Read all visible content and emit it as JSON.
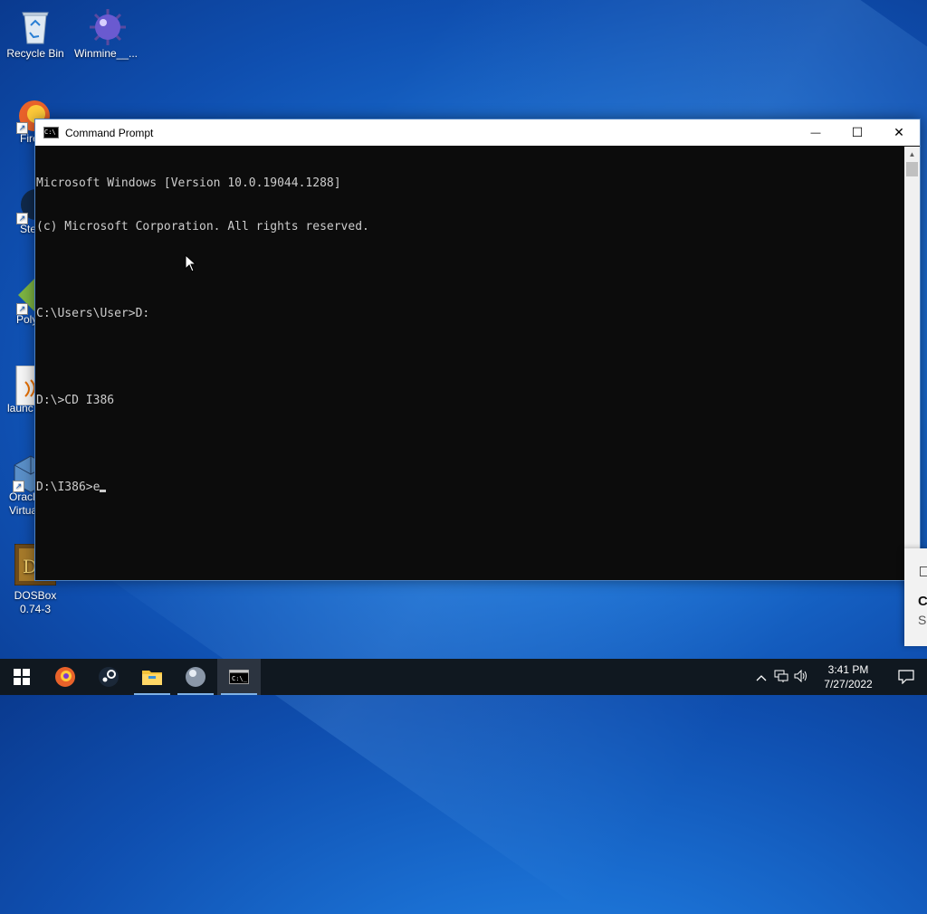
{
  "desktop": {
    "icons": [
      {
        "label": "Recycle Bin",
        "icon": "recycle-bin-icon"
      },
      {
        "label": "Winmine__...",
        "icon": "minesweeper-icon"
      },
      {
        "label": "Fire",
        "icon": "firefox-icon"
      },
      {
        "label": "Ste",
        "icon": "steam-icon"
      },
      {
        "label": "Poly",
        "icon": "poly-icon"
      },
      {
        "label": "launc",
        "icon": "java-launcher-icon"
      },
      {
        "label": "Oracl Virtua",
        "icon": "virtualbox-icon"
      },
      {
        "label": "DOSBox 0.74-3",
        "icon": "dosbox-icon"
      }
    ]
  },
  "window": {
    "title": "Command Prompt",
    "controls": {
      "minimize": "—",
      "maximize": "☐",
      "close": "✕"
    },
    "console_lines": [
      "Microsoft Windows [Version 10.0.19044.1288]",
      "(c) Microsoft Corporation. All rights reserved.",
      "",
      "C:\\Users\\User>D:",
      "",
      "D:\\>CD I386",
      "",
      "D:\\I386>e"
    ]
  },
  "notification": {
    "letters": [
      "C",
      "S"
    ]
  },
  "taskbar": {
    "items": [
      {
        "icon": "windows-start-icon"
      },
      {
        "icon": "firefox-icon"
      },
      {
        "icon": "steam-icon"
      },
      {
        "icon": "file-explorer-icon"
      },
      {
        "icon": "sphere-app-icon"
      },
      {
        "icon": "command-prompt-icon"
      }
    ],
    "clock": {
      "time": "3:41 PM",
      "date": "7/27/2022"
    }
  }
}
